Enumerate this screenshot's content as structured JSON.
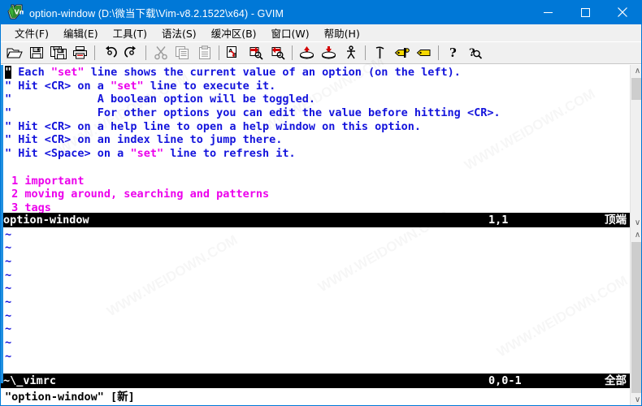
{
  "window": {
    "title": "option-window (D:\\微当下载\\Vim-v8.2.1522\\x64) - GVIM",
    "icon": "vim-icon",
    "titlebar_color": "#0078d7",
    "minimize_label": "—",
    "maximize_label": "□",
    "close_label": "✕"
  },
  "menubar": {
    "items": [
      {
        "label": "文件(F)",
        "name": "menu-file"
      },
      {
        "label": "编辑(E)",
        "name": "menu-edit"
      },
      {
        "label": "工具(T)",
        "name": "menu-tools"
      },
      {
        "label": "语法(S)",
        "name": "menu-syntax"
      },
      {
        "label": "缓冲区(B)",
        "name": "menu-buffers"
      },
      {
        "label": "窗口(W)",
        "name": "menu-window"
      },
      {
        "label": "帮助(H)",
        "name": "menu-help"
      }
    ]
  },
  "toolbar": {
    "buttons": [
      {
        "icon": "open-file-icon",
        "tip": "打开"
      },
      {
        "icon": "save-icon",
        "tip": "保存"
      },
      {
        "icon": "save-all-icon",
        "tip": "全部保存"
      },
      {
        "icon": "print-icon",
        "tip": "打印"
      },
      {
        "sep": true
      },
      {
        "icon": "undo-icon",
        "tip": "撤销"
      },
      {
        "icon": "redo-icon",
        "tip": "重做"
      },
      {
        "sep": true
      },
      {
        "icon": "cut-icon",
        "tip": "剪切"
      },
      {
        "icon": "copy-icon",
        "tip": "复制"
      },
      {
        "icon": "paste-icon",
        "tip": "粘贴"
      },
      {
        "sep": true
      },
      {
        "icon": "find-replace-icon",
        "tip": "查找替换"
      },
      {
        "icon": "find-next-icon",
        "tip": "查找下一个"
      },
      {
        "icon": "find-prev-icon",
        "tip": "查找上一个"
      },
      {
        "sep": true
      },
      {
        "icon": "load-session-icon",
        "tip": "载入会话"
      },
      {
        "icon": "save-session-icon",
        "tip": "保存会话"
      },
      {
        "icon": "run-script-icon",
        "tip": "运行脚本"
      },
      {
        "sep": true
      },
      {
        "icon": "make-icon",
        "tip": "构建"
      },
      {
        "icon": "build-tags-icon",
        "tip": "生成标签"
      },
      {
        "icon": "jump-tag-icon",
        "tip": "跳转标签"
      },
      {
        "sep": true
      },
      {
        "icon": "help-icon",
        "tip": "帮助"
      },
      {
        "icon": "find-help-icon",
        "tip": "查找帮助"
      }
    ]
  },
  "editor": {
    "top_window": {
      "cursor_char": "\"",
      "lines": [
        {
          "segments": [
            {
              "text": "\"",
              "color": "cursor"
            },
            {
              "text": " Each ",
              "color": "blue"
            },
            {
              "text": "\"set\"",
              "color": "magenta"
            },
            {
              "text": " line shows the current value of an option (on the left).",
              "color": "blue"
            }
          ]
        },
        {
          "segments": [
            {
              "text": "\" Hit <CR> on a ",
              "color": "blue"
            },
            {
              "text": "\"set\"",
              "color": "magenta"
            },
            {
              "text": " line to execute it.",
              "color": "blue"
            }
          ]
        },
        {
          "segments": [
            {
              "text": "\"             A boolean option will be toggled.",
              "color": "blue"
            }
          ]
        },
        {
          "segments": [
            {
              "text": "\"             For other options you can edit the value before hitting <CR>.",
              "color": "blue"
            }
          ]
        },
        {
          "segments": [
            {
              "text": "\" Hit <CR> on a help line to open a help window on this option.",
              "color": "blue"
            }
          ]
        },
        {
          "segments": [
            {
              "text": "\" Hit <CR> on an index line to jump there.",
              "color": "blue"
            }
          ]
        },
        {
          "segments": [
            {
              "text": "\" Hit <Space> on a ",
              "color": "blue"
            },
            {
              "text": "\"set\"",
              "color": "magenta"
            },
            {
              "text": " line to refresh it.",
              "color": "blue"
            }
          ]
        },
        {
          "segments": [
            {
              "text": "",
              "color": "blue"
            }
          ]
        },
        {
          "segments": [
            {
              "text": " 1 important",
              "color": "magenta"
            }
          ]
        },
        {
          "segments": [
            {
              "text": " 2 moving around, searching and patterns",
              "color": "magenta"
            }
          ]
        },
        {
          "segments": [
            {
              "text": " 3 tags",
              "color": "magenta"
            }
          ]
        }
      ],
      "status": {
        "name": "option-window",
        "position": "1,1",
        "relative": "顶端"
      },
      "scrollbar": {
        "up": "∧",
        "down": "∨",
        "thumb_pos_pct": 0,
        "thumb_size_pct": 15
      }
    },
    "bottom_window": {
      "tilde": "~",
      "tilde_rows": 10,
      "status": {
        "name": "~\\_vimrc",
        "position": "0,0-1",
        "relative": "全部"
      },
      "scrollbar": {
        "up": "∧",
        "down": "∨",
        "thumb_pos_pct": 0,
        "thumb_size_pct": 100
      }
    },
    "command_line": "\"option-window\" [新]"
  },
  "colors": {
    "comment_blue": "#1414dc",
    "header_magenta": "#ec00ec",
    "status_bg": "#000000",
    "status_fg": "#ffffff",
    "accent": "#0078d7"
  },
  "watermarks": [
    "WWW.WEIDOWN.COM",
    "WWW.WEIDOWN.COM",
    "WWW.WEIDOWN.COM",
    "WWW.WEIDOWN.COM",
    "WWW.WEIDOWN.COM",
    "WWW.WEIDOWN.COM"
  ]
}
